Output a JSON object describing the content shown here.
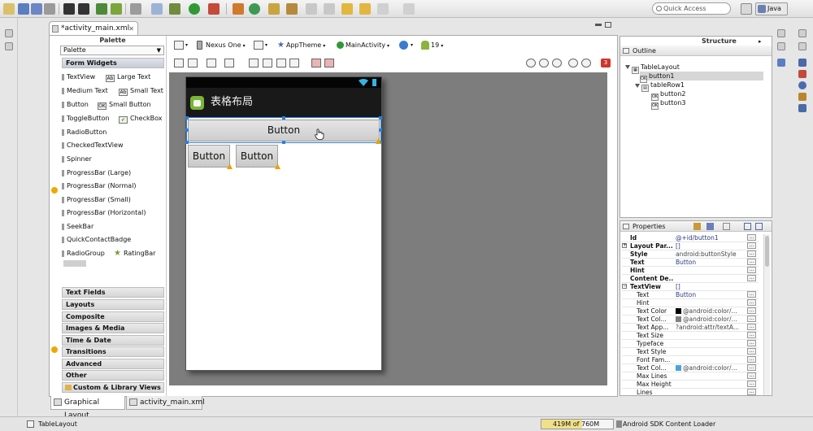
{
  "toolbar": {
    "quick_access_placeholder": "Quick Access",
    "perspective": "Java"
  },
  "editor": {
    "tab_title": "*activity_main.xml",
    "bottom_tabs": [
      "Graphical Layout",
      "activity_main.xml"
    ]
  },
  "palette": {
    "title": "Palette",
    "dropdown": "Palette",
    "form_widgets_header": "Form Widgets",
    "widget_rows": [
      [
        "TextView",
        "Large Text"
      ],
      [
        "Medium Text",
        "Small Text"
      ],
      [
        "Button",
        "Small Button"
      ],
      [
        "ToggleButton",
        "CheckBox"
      ],
      [
        "RadioButton"
      ],
      [
        "CheckedTextView"
      ],
      [
        "Spinner"
      ],
      [
        "ProgressBar (Large)"
      ],
      [
        "ProgressBar (Normal)"
      ],
      [
        "ProgressBar (Small)"
      ],
      [
        "ProgressBar (Horizontal)"
      ],
      [
        "SeekBar"
      ],
      [
        "QuickContactBadge"
      ],
      [
        "RadioGroup",
        "RatingBar"
      ]
    ],
    "categories": [
      "Text Fields",
      "Layouts",
      "Composite",
      "Images & Media",
      "Time & Date",
      "Transitions",
      "Advanced",
      "Other",
      "Custom & Library Views"
    ]
  },
  "layout_toolbar": {
    "device": "Nexus One",
    "theme": "AppTheme",
    "activity": "MainActivity",
    "api": "19",
    "error_count": "3"
  },
  "phone": {
    "app_title": "表格布局",
    "button1_label": "Button",
    "button2_label": "Button",
    "button3_label": "Button"
  },
  "outline": {
    "panel_title": "Structure",
    "tab": "Outline",
    "nodes": [
      "TableLayout",
      "button1",
      "tableRow1",
      "button2",
      "button3"
    ]
  },
  "properties": {
    "title": "Properties",
    "rows": [
      {
        "name": "Id",
        "value": "@+id/button1"
      },
      {
        "name": "Layout Par...",
        "value": "[]"
      },
      {
        "name": "Style",
        "value": "android:buttonStyle"
      },
      {
        "name": "Text",
        "value": "Button"
      },
      {
        "name": "Hint",
        "value": ""
      },
      {
        "name": "Content De...",
        "value": ""
      },
      {
        "name": "TextView",
        "value": "[]"
      },
      {
        "name": "Text",
        "value": "Button"
      },
      {
        "name": "Hint",
        "value": ""
      },
      {
        "name": "Text Color",
        "value": "@android:color/..."
      },
      {
        "name": "Text Col...",
        "value": "@android:color/..."
      },
      {
        "name": "Text App...",
        "value": "?android:attr/textA..."
      },
      {
        "name": "Text Size",
        "value": ""
      },
      {
        "name": "Typeface",
        "value": ""
      },
      {
        "name": "Text Style",
        "value": ""
      },
      {
        "name": "Font Fam...",
        "value": ""
      },
      {
        "name": "Text Col...",
        "value": "@android:color/..."
      },
      {
        "name": "Max Lines",
        "value": ""
      },
      {
        "name": "Max Height",
        "value": ""
      },
      {
        "name": "Lines",
        "value": ""
      }
    ]
  },
  "status": {
    "selection": "TableLayout",
    "heap_used": "419M",
    "heap_sep": "of",
    "heap_total": "760M",
    "task": "Android SDK Content Loader"
  }
}
